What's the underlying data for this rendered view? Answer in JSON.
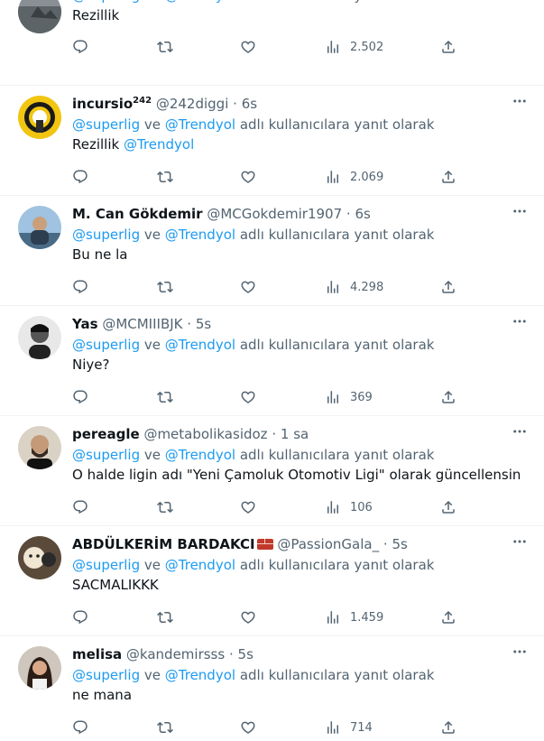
{
  "reply_prefix": "adlı kullanıcılara yanıt olarak",
  "reply_mentions": [
    "@superlig",
    "@Trendyol"
  ],
  "reply_joiner": "ve",
  "tweets": [
    {
      "name": "",
      "handle": "",
      "time": "",
      "text": "Rezillik",
      "views": "2.502"
    },
    {
      "name": "incursio",
      "name_sup": "242",
      "handle": "@242diggi",
      "time": "6s",
      "text": "Rezillik",
      "text_mention": "@Trendyol",
      "views": "2.069"
    },
    {
      "name": "M. Can Gökdemir",
      "handle": "@MCGokdemir1907",
      "time": "6s",
      "text": "Bu ne la",
      "views": "4.298"
    },
    {
      "name": "Yas",
      "handle": "@MCMIIIBJK",
      "time": "5s",
      "text": "Niye?",
      "views": "369"
    },
    {
      "name": "pereagle",
      "handle": "@metabolikasidoz",
      "time": "1 sa",
      "text": "O halde ligin adı \"Yeni Çamoluk Otomotiv Ligi\" olarak güncellensin",
      "views": "106"
    },
    {
      "name": "ABDÜLKERİM BARDAKCI",
      "handle": "@PassionGala_",
      "time": "5s",
      "text": "SACMALIKKK",
      "views": "1.459"
    },
    {
      "name": "melisa",
      "handle": "@kandemirsss",
      "time": "5s",
      "text": "ne mana",
      "views": "714"
    }
  ],
  "colors": {
    "link": "#1d9bf0",
    "secondary": "#536471",
    "divider": "#eff3f4"
  },
  "icons": [
    "more-icon",
    "reply-icon",
    "retweet-icon",
    "like-icon",
    "views-icon",
    "share-icon",
    "brick-emoji-icon"
  ]
}
